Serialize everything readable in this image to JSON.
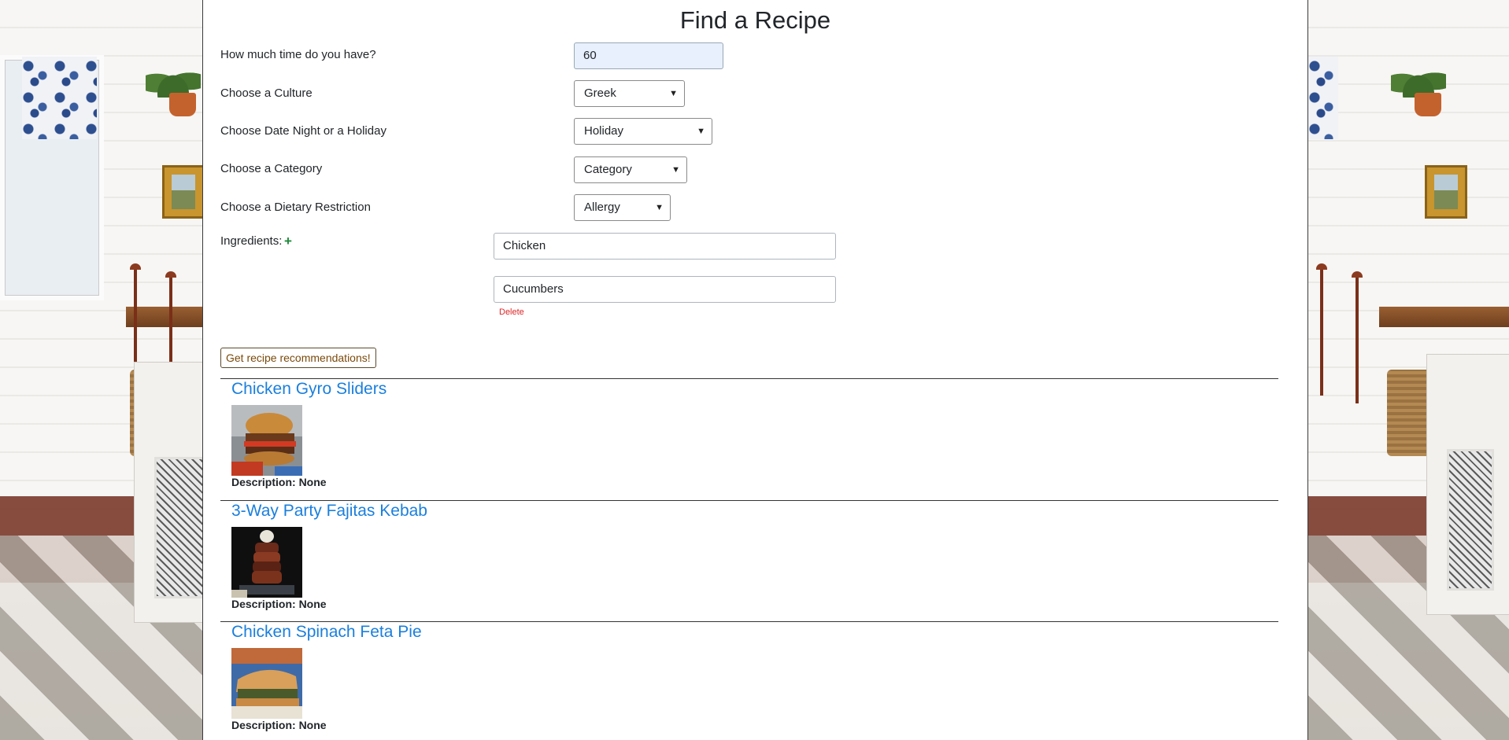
{
  "page": {
    "title": "Find a Recipe"
  },
  "form": {
    "time_label": "How much time do you have?",
    "time_value": "60",
    "culture_label": "Choose a Culture",
    "culture_value": "Greek",
    "occasion_label": "Choose Date Night or a Holiday",
    "occasion_value": "Holiday",
    "category_label": "Choose a Category",
    "category_value": "Category",
    "diet_label": "Choose a Dietary Restriction",
    "diet_value": "Allergy",
    "ingredients_label": "Ingredients:",
    "add_ingredient": "+",
    "ingredients": [
      "Chicken",
      "Cucumbers"
    ],
    "delete_label": "Delete",
    "submit_label": "Get recipe recommendations!"
  },
  "results": [
    {
      "title": "Chicken Gyro Sliders",
      "description": "Description: None",
      "thumb_icon": "slider-burger-photo"
    },
    {
      "title": "3-Way Party Fajitas Kebab",
      "description": "Description: None",
      "thumb_icon": "kebab-skewer-photo"
    },
    {
      "title": "Chicken Spinach Feta Pie",
      "description": "Description: None",
      "thumb_icon": "pie-slice-photo"
    }
  ],
  "colors": {
    "link": "#1a7fdc",
    "delete": "#dc2626",
    "add": "#1e8a3a",
    "input_autofill": "#e8f0fe"
  },
  "icons": {
    "select_chevron": "chevron-down-icon"
  }
}
